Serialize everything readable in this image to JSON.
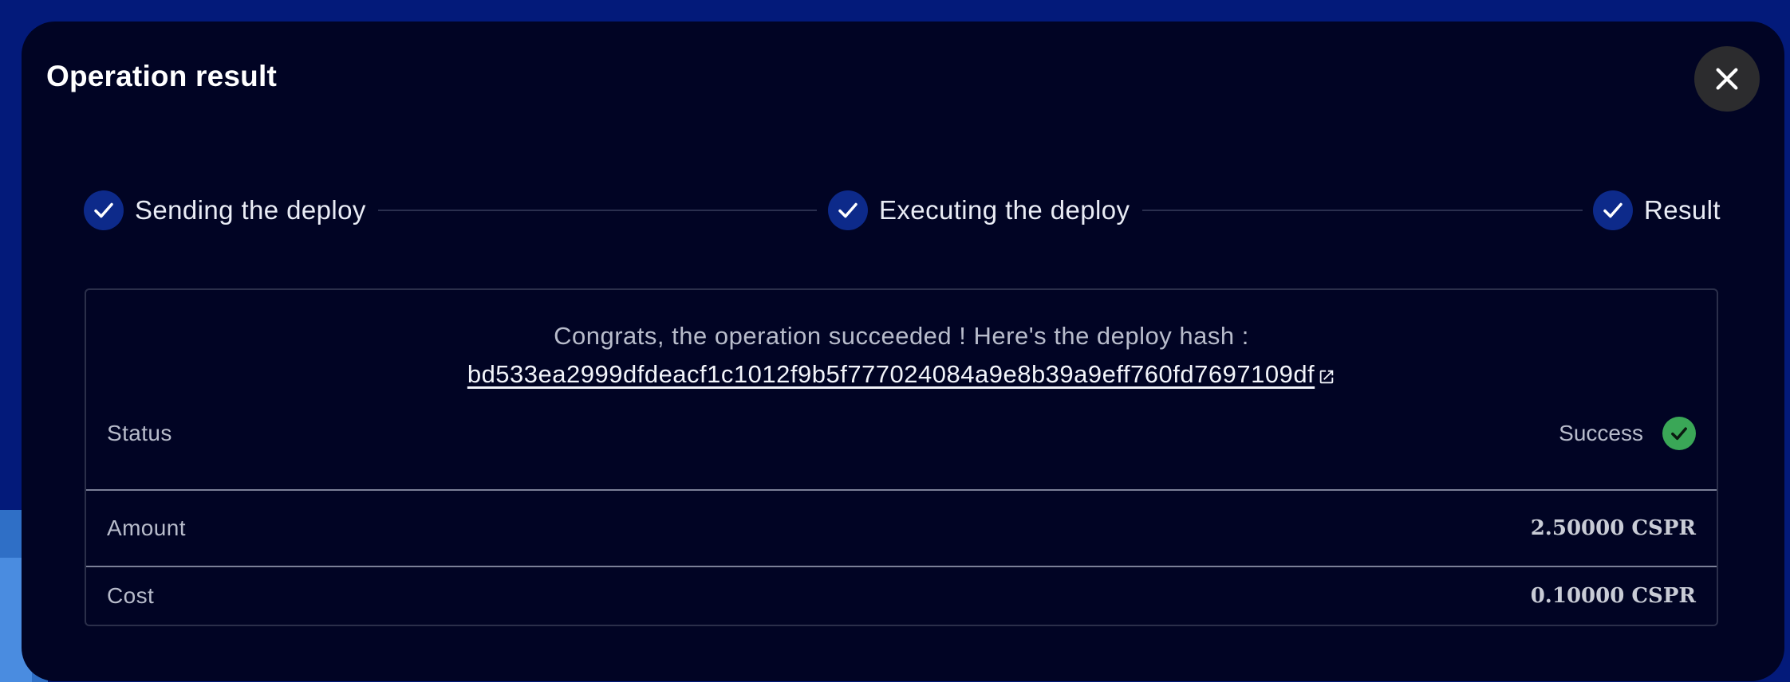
{
  "modal": {
    "title": "Operation result",
    "close_icon": "close-icon"
  },
  "stepper": {
    "steps": [
      {
        "label": "Sending the deploy",
        "icon": "check-icon",
        "state": "completed"
      },
      {
        "label": "Executing the deploy",
        "icon": "check-icon",
        "state": "completed"
      },
      {
        "label": "Result",
        "icon": "check-icon",
        "state": "completed"
      }
    ]
  },
  "result": {
    "message": "Congrats, the operation succeeded ! Here's the deploy hash :",
    "deploy_hash": "bd533ea2999dfdeacf1c1012f9b5f777024084a9e8b39a9eff760fd7697109df",
    "rows": [
      {
        "label": "Status",
        "value": "Success",
        "icon": "success-check-icon"
      },
      {
        "label": "Amount",
        "value": "2.50000 CSPR"
      },
      {
        "label": "Cost",
        "value": "0.10000 CSPR"
      }
    ]
  },
  "colors": {
    "background": "#031a7a",
    "modal": "#010424",
    "step_icon": "#0d2a8a",
    "success": "#3aa757"
  }
}
